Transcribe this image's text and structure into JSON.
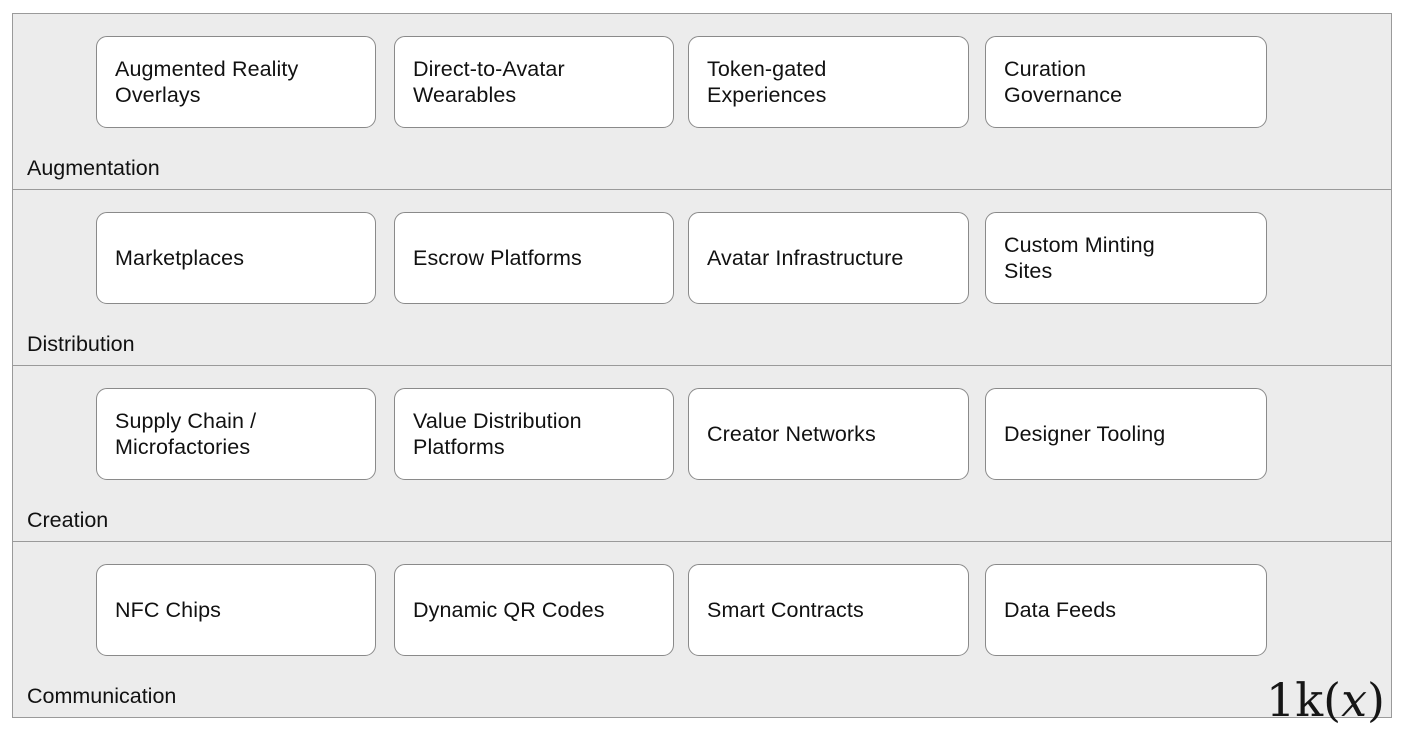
{
  "diagram": {
    "type": "layered-stack",
    "background_color": "#ececec",
    "border_color": "#9a9a9a",
    "node_fill": "#ffffff",
    "node_border": "#8a8a8a",
    "text_color": "#111111",
    "bands": [
      {
        "title": "Augmentation",
        "nodes": [
          {
            "label": "Augmented Reality\nOverlays"
          },
          {
            "label": "Direct-to-Avatar\nWearables"
          },
          {
            "label": "Token-gated\nExperiences"
          },
          {
            "label": "Curation\nGovernance"
          }
        ]
      },
      {
        "title": "Distribution",
        "nodes": [
          {
            "label": "Marketplaces"
          },
          {
            "label": "Escrow Platforms"
          },
          {
            "label": "Avatar Infrastructure"
          },
          {
            "label": "Custom Minting\nSites"
          }
        ]
      },
      {
        "title": "Creation",
        "nodes": [
          {
            "label": "Supply Chain /\nMicrofactories"
          },
          {
            "label": "Value Distribution\nPlatforms"
          },
          {
            "label": "Creator Networks"
          },
          {
            "label": "Designer Tooling"
          }
        ]
      },
      {
        "title": "Communication",
        "nodes": [
          {
            "label": "NFC Chips"
          },
          {
            "label": "Dynamic QR Codes"
          },
          {
            "label": "Smart Contracts"
          },
          {
            "label": "Data Feeds"
          }
        ]
      }
    ]
  },
  "watermark": {
    "prefix": "1k(",
    "variable": "x",
    "suffix": ")"
  }
}
